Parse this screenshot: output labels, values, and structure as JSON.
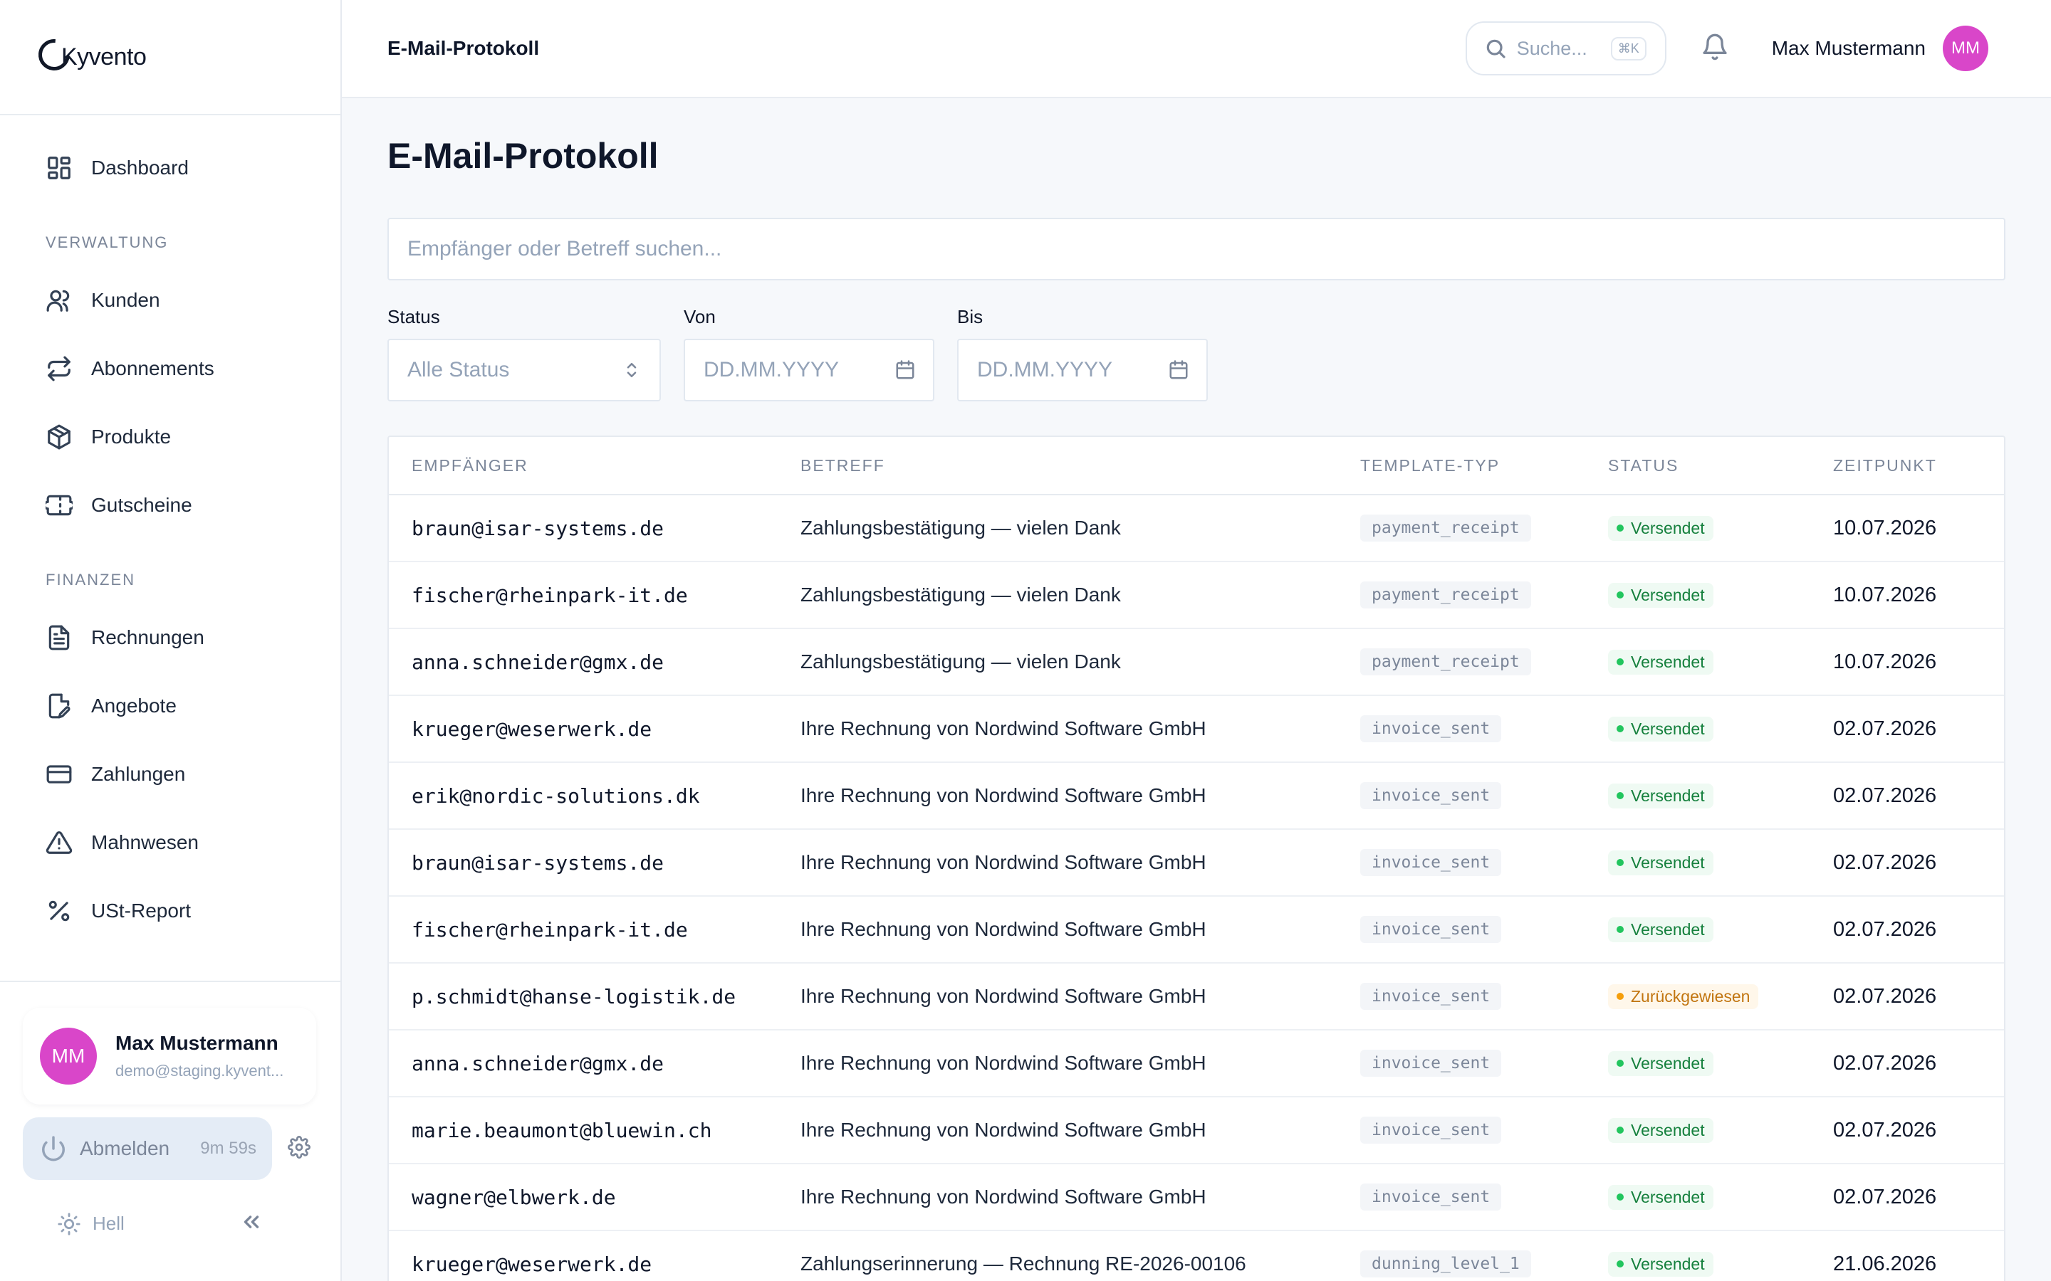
{
  "brand": {
    "name": "Kyvento"
  },
  "sidebar": {
    "dashboard": {
      "label": "Dashboard"
    },
    "sections": [
      {
        "title": "VERWALTUNG",
        "items": [
          {
            "label": "Kunden"
          },
          {
            "label": "Abonnements"
          },
          {
            "label": "Produkte"
          },
          {
            "label": "Gutscheine"
          }
        ]
      },
      {
        "title": "FINANZEN",
        "items": [
          {
            "label": "Rechnungen"
          },
          {
            "label": "Angebote"
          },
          {
            "label": "Zahlungen"
          },
          {
            "label": "Mahnwesen"
          },
          {
            "label": "USt-Report"
          }
        ]
      }
    ],
    "user": {
      "initials": "MM",
      "name": "Max Mustermann",
      "email": "demo@staging.kyvent..."
    },
    "logout": {
      "label": "Abmelden",
      "timer": "9m 59s"
    },
    "theme": {
      "label": "Hell"
    }
  },
  "topbar": {
    "title": "E-Mail-Protokoll",
    "search_placeholder": "Suche...",
    "shortcut": "⌘K",
    "user_name": "Max Mustermann",
    "user_initials": "MM"
  },
  "page": {
    "title": "E-Mail-Protokoll",
    "search_placeholder": "Empfänger oder Betreff suchen...",
    "filters": {
      "status": {
        "label": "Status",
        "placeholder": "Alle Status"
      },
      "von": {
        "label": "Von",
        "placeholder": "DD.MM.YYYY"
      },
      "bis": {
        "label": "Bis",
        "placeholder": "DD.MM.YYYY"
      }
    }
  },
  "table": {
    "headers": [
      "EMPFÄNGER",
      "BETREFF",
      "TEMPLATE-TYP",
      "STATUS",
      "ZEITPUNKT"
    ],
    "rows": [
      {
        "recipient": "braun@isar-systems.de",
        "subject": "Zahlungsbestätigung — vielen Dank",
        "template": "payment_receipt",
        "status": "Versendet",
        "status_kind": "sent",
        "time": "10.07.2026"
      },
      {
        "recipient": "fischer@rheinpark-it.de",
        "subject": "Zahlungsbestätigung — vielen Dank",
        "template": "payment_receipt",
        "status": "Versendet",
        "status_kind": "sent",
        "time": "10.07.2026"
      },
      {
        "recipient": "anna.schneider@gmx.de",
        "subject": "Zahlungsbestätigung — vielen Dank",
        "template": "payment_receipt",
        "status": "Versendet",
        "status_kind": "sent",
        "time": "10.07.2026"
      },
      {
        "recipient": "krueger@weserwerk.de",
        "subject": "Ihre Rechnung von Nordwind Software GmbH",
        "template": "invoice_sent",
        "status": "Versendet",
        "status_kind": "sent",
        "time": "02.07.2026"
      },
      {
        "recipient": "erik@nordic-solutions.dk",
        "subject": "Ihre Rechnung von Nordwind Software GmbH",
        "template": "invoice_sent",
        "status": "Versendet",
        "status_kind": "sent",
        "time": "02.07.2026"
      },
      {
        "recipient": "braun@isar-systems.de",
        "subject": "Ihre Rechnung von Nordwind Software GmbH",
        "template": "invoice_sent",
        "status": "Versendet",
        "status_kind": "sent",
        "time": "02.07.2026"
      },
      {
        "recipient": "fischer@rheinpark-it.de",
        "subject": "Ihre Rechnung von Nordwind Software GmbH",
        "template": "invoice_sent",
        "status": "Versendet",
        "status_kind": "sent",
        "time": "02.07.2026"
      },
      {
        "recipient": "p.schmidt@hanse-logistik.de",
        "subject": "Ihre Rechnung von Nordwind Software GmbH",
        "template": "invoice_sent",
        "status": "Zurückgewiesen",
        "status_kind": "rejected",
        "time": "02.07.2026"
      },
      {
        "recipient": "anna.schneider@gmx.de",
        "subject": "Ihre Rechnung von Nordwind Software GmbH",
        "template": "invoice_sent",
        "status": "Versendet",
        "status_kind": "sent",
        "time": "02.07.2026"
      },
      {
        "recipient": "marie.beaumont@bluewin.ch",
        "subject": "Ihre Rechnung von Nordwind Software GmbH",
        "template": "invoice_sent",
        "status": "Versendet",
        "status_kind": "sent",
        "time": "02.07.2026"
      },
      {
        "recipient": "wagner@elbwerk.de",
        "subject": "Ihre Rechnung von Nordwind Software GmbH",
        "template": "invoice_sent",
        "status": "Versendet",
        "status_kind": "sent",
        "time": "02.07.2026"
      },
      {
        "recipient": "krueger@weserwerk.de",
        "subject": "Zahlungserinnerung — Rechnung RE-2026-00106",
        "template": "dunning_level_1",
        "status": "Versendet",
        "status_kind": "sent",
        "time": "21.06.2026"
      }
    ]
  },
  "colors": {
    "accent_avatar": "#d946c9",
    "status_sent": "#22c55e",
    "status_rejected": "#f59e0b"
  }
}
